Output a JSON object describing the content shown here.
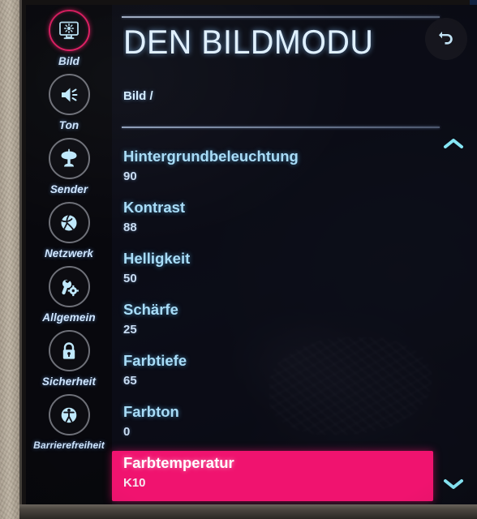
{
  "device": {
    "screen_label": "tv-screen"
  },
  "header": {
    "title": "DEN BILDMODU",
    "breadcrumb": "Bild /",
    "back_icon": "back-arrow-icon"
  },
  "scroll": {
    "up_icon": "chevron-up-icon",
    "down_icon": "chevron-down-icon"
  },
  "colors": {
    "accent_pink": "#f0136f",
    "selected_ring": "#e31c63",
    "label_blue": "#a8dcf7",
    "value_blue": "#c9dcf2",
    "title_white": "#dff0ff"
  },
  "sidebar": {
    "items": [
      {
        "label": "Bild",
        "icon": "display-brightness-icon",
        "selected": true
      },
      {
        "label": "Ton",
        "icon": "speaker-icon",
        "selected": false
      },
      {
        "label": "Sender",
        "icon": "satellite-dish-icon",
        "selected": false
      },
      {
        "label": "Netzwerk",
        "icon": "globe-icon",
        "selected": false
      },
      {
        "label": "Allgemein",
        "icon": "wrench-gear-icon",
        "selected": false
      },
      {
        "label": "Sicherheit",
        "icon": "lock-icon",
        "selected": false
      },
      {
        "label": "Barrierefreiheit",
        "icon": "accessibility-icon",
        "selected": false
      }
    ]
  },
  "settings_list": {
    "rows": [
      {
        "label": "Hintergrundbeleuchtung",
        "value": "90",
        "highlighted": false
      },
      {
        "label": "Kontrast",
        "value": "88",
        "highlighted": false
      },
      {
        "label": "Helligkeit",
        "value": "50",
        "highlighted": false
      },
      {
        "label": "Schärfe",
        "value": "25",
        "highlighted": false
      },
      {
        "label": "Farbtiefe",
        "value": "65",
        "highlighted": false
      },
      {
        "label": "Farbton",
        "value": "0",
        "highlighted": false
      },
      {
        "label": "Farbtemperatur",
        "value": "K10",
        "highlighted": true
      }
    ]
  }
}
